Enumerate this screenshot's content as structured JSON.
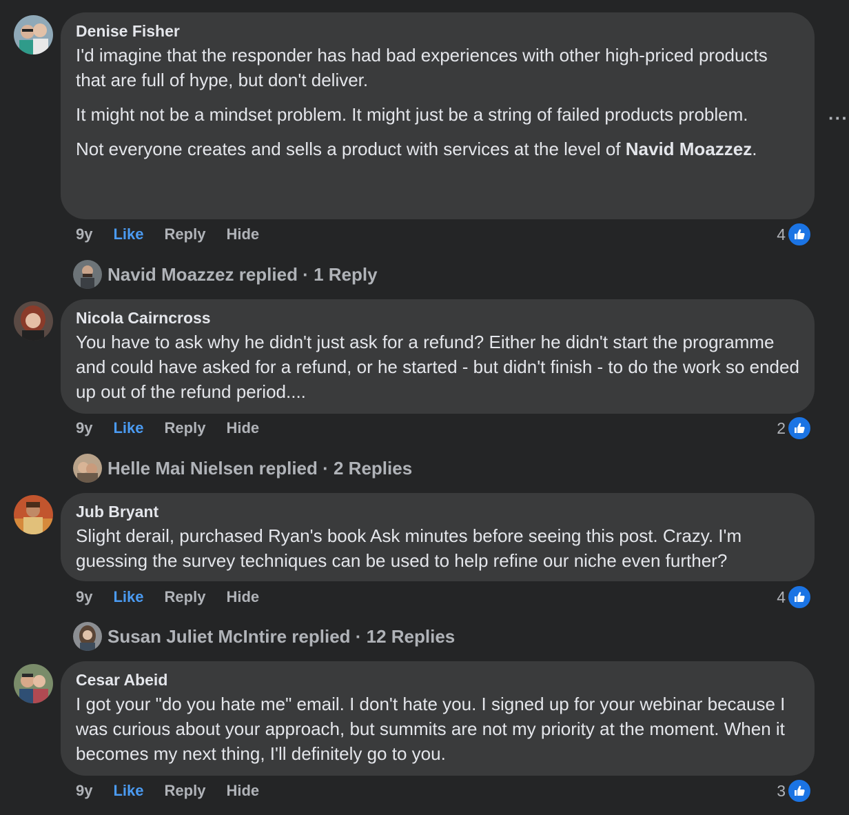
{
  "more_label": "···",
  "comments": [
    {
      "author": "Denise Fisher",
      "paragraphs": [
        "I'd imagine that the responder has had bad experiences with other high-priced products that are full of hype, but don't deliver.",
        "It might not be a mindset problem. It might just be a string of failed products problem.",
        "Not everyone creates and sells a product with services at the level of "
      ],
      "mention": "Navid Moazzez",
      "mention_suffix": ".",
      "age": "9y",
      "like": "Like",
      "reply": "Reply",
      "hide": "Hide",
      "reaction_count": "4",
      "replied_text": "Navid Moazzez replied · 1 Reply"
    },
    {
      "author": "Nicola Cairncross",
      "paragraphs": [
        "You have to ask why he didn't just ask for a refund? Either he didn't start the programme and could have asked for a refund, or he started - but didn't finish - to do the work so ended up out of the refund period...."
      ],
      "age": "9y",
      "like": "Like",
      "reply": "Reply",
      "hide": "Hide",
      "reaction_count": "2",
      "replied_text": "Helle Mai Nielsen replied · 2 Replies"
    },
    {
      "author": "Jub Bryant",
      "paragraphs": [
        "Slight derail, purchased Ryan's book Ask minutes before seeing this post. Crazy. I'm guessing the survey techniques can be used to help refine our niche even further?"
      ],
      "age": "9y",
      "like": "Like",
      "reply": "Reply",
      "hide": "Hide",
      "reaction_count": "4",
      "replied_text": "Susan Juliet McIntire replied · 12 Replies"
    },
    {
      "author": "Cesar Abeid",
      "paragraphs": [
        "I got your \"do you hate me\" email. I don't hate you. I signed up for your webinar because I was curious about your approach, but summits are not my priority at the moment. When it becomes my next thing, I'll definitely go to you."
      ],
      "age": "9y",
      "like": "Like",
      "reply": "Reply",
      "hide": "Hide",
      "reaction_count": "3"
    }
  ],
  "colors": {
    "background": "#242526",
    "bubble": "#3a3b3c",
    "like_blue": "#4b9bf2",
    "reaction_blue": "#1b74e4",
    "muted_text": "#b0b3b8"
  }
}
